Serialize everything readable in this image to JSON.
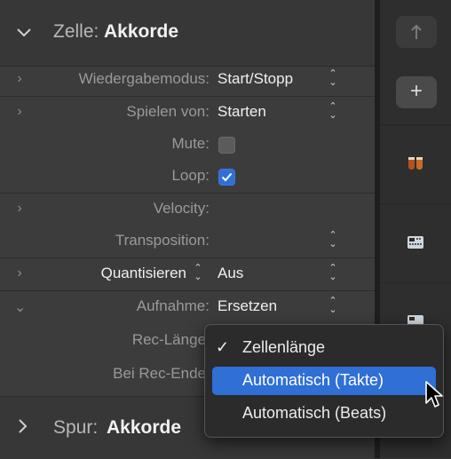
{
  "header": {
    "chevron": "chevron-down-icon",
    "label": "Zelle:",
    "value": "Akkorde"
  },
  "rows": [
    {
      "label": "Wiedergabemodus:",
      "value": "Start/Stopp"
    },
    {
      "label": "Spielen von:",
      "value": "Starten"
    },
    {
      "label": "Mute:",
      "checked": false
    },
    {
      "label": "Loop:",
      "checked": true
    },
    {
      "label": "Velocity:"
    },
    {
      "label": "Transposition:"
    },
    {
      "label": "Quantisieren",
      "value": "Aus"
    },
    {
      "label": "Aufnahme:",
      "value": "Ersetzen"
    },
    {
      "label": "Rec-Länge"
    },
    {
      "label": "Bei Rec-Ende"
    }
  ],
  "footer": {
    "label": "Spur:",
    "value": "Akkorde"
  },
  "toolbar": {
    "up_icon": "up-arrow-icon",
    "add_label": "+"
  },
  "tracks": [
    {
      "icon": "percussion-icon"
    },
    {
      "icon": "drum-machine-icon"
    },
    {
      "icon": "drum-machine-icon"
    }
  ],
  "menu": {
    "items": [
      {
        "label": "Zellenlänge",
        "checked": true,
        "check_glyph": "✓"
      },
      {
        "label": "Automatisch (Takte)",
        "highlighted": true
      },
      {
        "label": "Automatisch (Beats)"
      }
    ]
  },
  "colors": {
    "accent": "#2f6fd6",
    "panel": "#3c3c3c",
    "popup": "#2b2b2b"
  }
}
